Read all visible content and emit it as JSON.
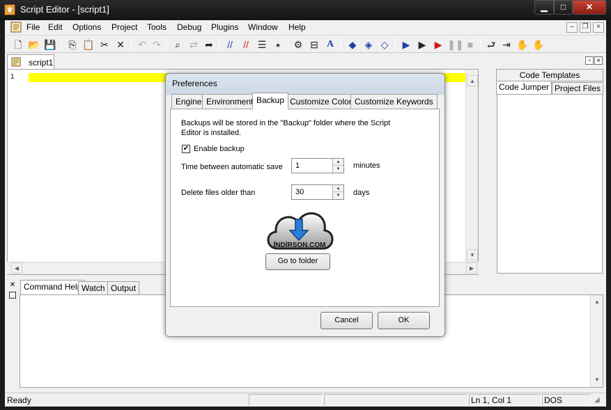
{
  "window": {
    "title": "Script Editor - [script1]",
    "controls": {
      "minimize": "▁",
      "maximize": "□",
      "close": "✕"
    }
  },
  "menu": {
    "items": [
      "File",
      "Edit",
      "Options",
      "Project",
      "Tools",
      "Debug",
      "Plugins",
      "Window",
      "Help"
    ],
    "mdi": {
      "minimize": "–",
      "restore": "❐",
      "close": "×"
    }
  },
  "toolbar": {
    "icons": [
      "new-file-icon",
      "open-folder-icon",
      "save-icon",
      "copy-icon",
      "paste-icon",
      "cut-icon",
      "delete-icon",
      "undo-icon",
      "redo-icon",
      "find-icon",
      "replace-icon",
      "goto-icon",
      "comment-icon",
      "uncomment-icon",
      "indent-icon",
      "bookmark-icon",
      "settings-icon",
      "properties-icon",
      "font-icon",
      "breakpoint-icon",
      "step-into-icon",
      "step-over-icon",
      "run-icon",
      "run-to-cursor-icon",
      "run-red-icon",
      "pause-icon",
      "stop-icon",
      "code-jump-icon",
      "code-insert-icon",
      "hand-icon",
      "hand-multi-icon"
    ]
  },
  "editor": {
    "tab_label": "script1",
    "line_number": "1",
    "highlight_color": "#ffff00"
  },
  "right_panel": {
    "tab_code_templates": "Code Templates",
    "tab_code_jumper": "Code Jumper",
    "tab_project_files": "Project Files"
  },
  "bottom_panel": {
    "tabs": [
      "Command Help",
      "Watch",
      "Output"
    ]
  },
  "status_bar": {
    "status": "Ready",
    "position": "Ln 1, Col 1",
    "line_ending": "DOS"
  },
  "dialog": {
    "title": "Preferences",
    "tabs": [
      "Engine",
      "Environment",
      "Backup",
      "Customize Colors",
      "Customize Keywords"
    ],
    "active_tab": "Backup",
    "description": "Backups will be stored in the \"Backup\" folder where the Script Editor is installed.",
    "enable_backup_label": "Enable backup",
    "enable_backup_checked": true,
    "autosave_label": "Time between automatic save",
    "autosave_value": "1",
    "autosave_unit": "minutes",
    "delete_label": "Delete files older than",
    "delete_value": "30",
    "delete_unit": "days",
    "watermark_text": "İNDİRSON.COM",
    "goto_folder_label": "Go to folder",
    "cancel_label": "Cancel",
    "ok_label": "OK"
  }
}
